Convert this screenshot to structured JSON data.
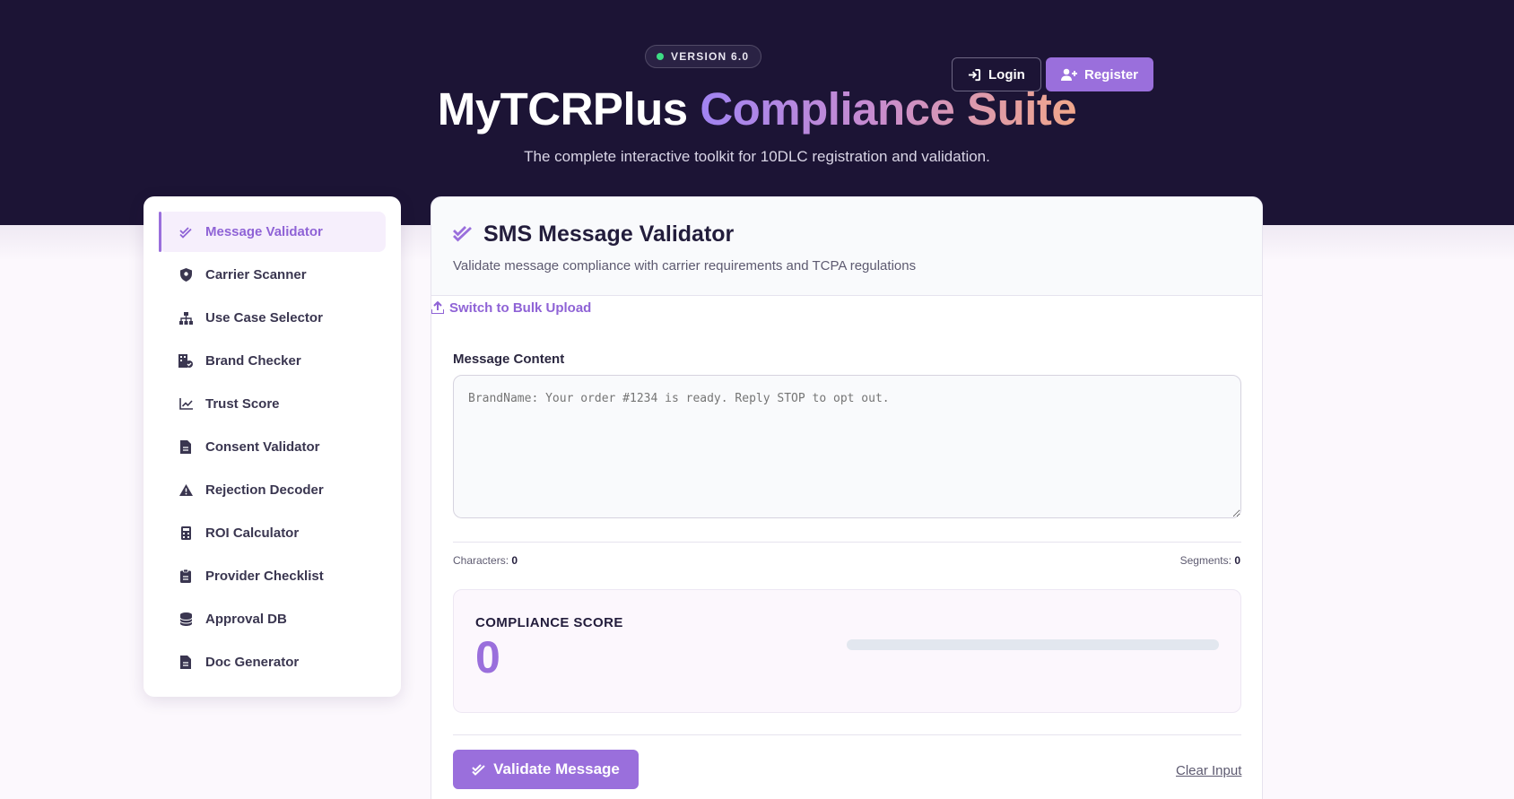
{
  "header": {
    "version": "VERSION 6.0",
    "title_main": "MyTCRPlus",
    "title_accent": "Compliance Suite",
    "subtitle": "The complete interactive toolkit for 10DLC registration and validation.",
    "login_label": "Login",
    "register_label": "Register"
  },
  "sidebar": {
    "items": [
      {
        "label": "Message Validator",
        "icon": "double-check-icon",
        "active": true
      },
      {
        "label": "Carrier Scanner",
        "icon": "shield-icon"
      },
      {
        "label": "Use Case Selector",
        "icon": "sitemap-icon"
      },
      {
        "label": "Brand Checker",
        "icon": "building-check-icon"
      },
      {
        "label": "Trust Score",
        "icon": "line-chart-icon"
      },
      {
        "label": "Consent Validator",
        "icon": "file-icon"
      },
      {
        "label": "Rejection Decoder",
        "icon": "warning-icon"
      },
      {
        "label": "ROI Calculator",
        "icon": "calculator-icon"
      },
      {
        "label": "Provider Checklist",
        "icon": "clipboard-icon"
      },
      {
        "label": "Approval DB",
        "icon": "database-icon"
      },
      {
        "label": "Doc Generator",
        "icon": "file-icon"
      }
    ]
  },
  "validator": {
    "title": "SMS Message Validator",
    "description": "Validate message compliance with carrier requirements and TCPA regulations",
    "bulk_link": "Switch to Bulk Upload",
    "content_label": "Message Content",
    "placeholder": "BrandName: Your order #1234 is ready. Reply STOP to opt out.",
    "characters_label": "Characters:",
    "characters_value": "0",
    "segments_label": "Segments:",
    "segments_value": "0",
    "score_label": "COMPLIANCE SCORE",
    "score_value": "0",
    "score_fraction": 0,
    "validate_label": "Validate Message",
    "clear_label": "Clear Input"
  },
  "colors": {
    "accent": "#9a6fdc",
    "hero_bg": "#1c1435",
    "status_dot": "#3ddc84"
  }
}
